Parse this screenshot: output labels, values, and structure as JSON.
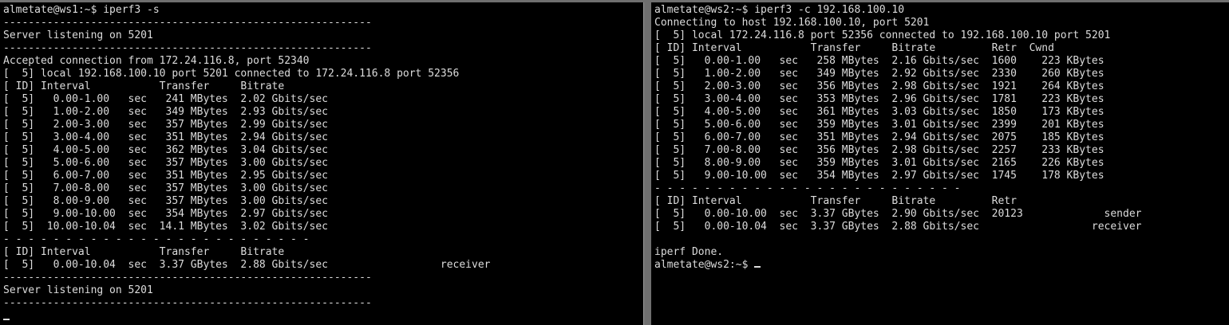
{
  "left_terminal": {
    "lines": [
      "almetate@ws1:~$ iperf3 -s",
      "-----------------------------------------------------------",
      "Server listening on 5201",
      "-----------------------------------------------------------",
      "Accepted connection from 172.24.116.8, port 52340",
      "[  5] local 192.168.100.10 port 5201 connected to 172.24.116.8 port 52356",
      "[ ID] Interval           Transfer     Bitrate",
      "[  5]   0.00-1.00   sec   241 MBytes  2.02 Gbits/sec",
      "[  5]   1.00-2.00   sec   349 MBytes  2.93 Gbits/sec",
      "[  5]   2.00-3.00   sec   357 MBytes  2.99 Gbits/sec",
      "[  5]   3.00-4.00   sec   351 MBytes  2.94 Gbits/sec",
      "[  5]   4.00-5.00   sec   362 MBytes  3.04 Gbits/sec",
      "[  5]   5.00-6.00   sec   357 MBytes  3.00 Gbits/sec",
      "[  5]   6.00-7.00   sec   351 MBytes  2.95 Gbits/sec",
      "[  5]   7.00-8.00   sec   357 MBytes  3.00 Gbits/sec",
      "[  5]   8.00-9.00   sec   357 MBytes  3.00 Gbits/sec",
      "[  5]   9.00-10.00  sec   354 MBytes  2.97 Gbits/sec",
      "[  5]  10.00-10.04  sec  14.1 MBytes  3.02 Gbits/sec",
      "- - - - - - - - - - - - - - - - - - - - - - - - -",
      "[ ID] Interval           Transfer     Bitrate",
      "[  5]   0.00-10.04  sec  3.37 GBytes  2.88 Gbits/sec                  receiver",
      "-----------------------------------------------------------",
      "Server listening on 5201",
      "-----------------------------------------------------------"
    ]
  },
  "right_terminal": {
    "lines": [
      "almetate@ws2:~$ iperf3 -c 192.168.100.10",
      "Connecting to host 192.168.100.10, port 5201",
      "[  5] local 172.24.116.8 port 52356 connected to 192.168.100.10 port 5201",
      "[ ID] Interval           Transfer     Bitrate         Retr  Cwnd",
      "[  5]   0.00-1.00   sec   258 MBytes  2.16 Gbits/sec  1600    223 KBytes",
      "[  5]   1.00-2.00   sec   349 MBytes  2.92 Gbits/sec  2330    260 KBytes",
      "[  5]   2.00-3.00   sec   356 MBytes  2.98 Gbits/sec  1921    264 KBytes",
      "[  5]   3.00-4.00   sec   353 MBytes  2.96 Gbits/sec  1781    223 KBytes",
      "[  5]   4.00-5.00   sec   361 MBytes  3.03 Gbits/sec  1850    173 KBytes",
      "[  5]   5.00-6.00   sec   359 MBytes  3.01 Gbits/sec  2399    201 KBytes",
      "[  5]   6.00-7.00   sec   351 MBytes  2.94 Gbits/sec  2075    185 KBytes",
      "[  5]   7.00-8.00   sec   356 MBytes  2.98 Gbits/sec  2257    233 KBytes",
      "[  5]   8.00-9.00   sec   359 MBytes  3.01 Gbits/sec  2165    226 KBytes",
      "[  5]   9.00-10.00  sec   354 MBytes  2.97 Gbits/sec  1745    178 KBytes",
      "- - - - - - - - - - - - - - - - - - - - - - - - -",
      "[ ID] Interval           Transfer     Bitrate         Retr",
      "[  5]   0.00-10.00  sec  3.37 GBytes  2.90 Gbits/sec  20123             sender",
      "[  5]   0.00-10.04  sec  3.37 GBytes  2.88 Gbits/sec                  receiver",
      "",
      "iperf Done.",
      "almetate@ws2:~$ "
    ]
  },
  "colors": {
    "terminal_bg": "#000000",
    "terminal_fg": "#dcdcdc",
    "divider": "#6f6f6f"
  }
}
